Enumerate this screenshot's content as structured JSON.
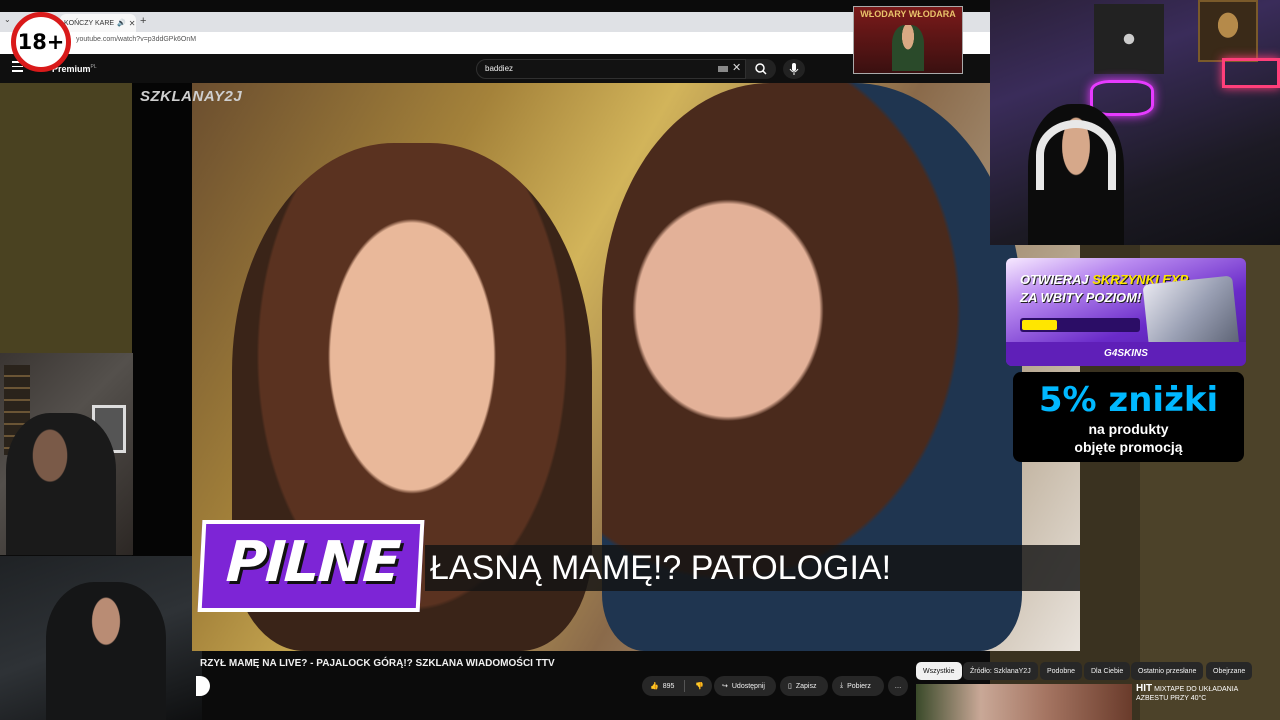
{
  "browser": {
    "tab_title": "KOŃCZY KARE",
    "tab_close": "✕",
    "new_tab": "+",
    "tab_menu": "⌄",
    "address": "youtube.com/watch?v=p3ddGPk6OnM"
  },
  "youtube": {
    "logo_text": "Premium",
    "region": "PL",
    "search_query": "baddiez",
    "clear_symbol": "✕"
  },
  "badge": {
    "text": "18+"
  },
  "video": {
    "watermark": "SZKLANAY2J",
    "tag": "PILNE",
    "headline": "ŁASNĄ MAMĘ!? PATOLOGIA!",
    "title": "RZYŁ MAMĘ NA LIVE? - PAJALOCK GÓRĄ!? SZKLANA WIADOMOŚCI TTV"
  },
  "actions": {
    "likes": "895",
    "share": "Udostępnij",
    "save": "Zapisz",
    "download": "Pobierz",
    "more": "…"
  },
  "chips": [
    {
      "label": "Wszystkie",
      "active": true
    },
    {
      "label": "Źródło: SzklanaY2J",
      "active": false
    },
    {
      "label": "Podobne",
      "active": false
    },
    {
      "label": "Dla Ciebie",
      "active": false
    },
    {
      "label": "Ostatnio przesłane",
      "active": false
    },
    {
      "label": "Obejrzane",
      "active": false
    }
  ],
  "recommended": {
    "brand": "HIT",
    "line1": "MIXTAPE DO UKŁADANIA",
    "line2": "AZBESTU PRZY 40°C"
  },
  "banner": {
    "text": "WŁODARY WŁODARA"
  },
  "ad_skins": {
    "line1_a": "OTWIERAJ",
    "line1_b": "SKRZYNKI EXP",
    "line2": "ZA WBITY POZIOM!",
    "brand": "G4SKINS",
    "progress": 0.3
  },
  "ad_discount": {
    "big": "5% zniżki",
    "line1": "na produkty",
    "line2": "objęte promocją"
  },
  "colors": {
    "accent_purple": "#7d25d6",
    "discount_blue": "#00b8ff",
    "badge_red": "#d91a1a",
    "skins_yellow": "#ffe600"
  }
}
